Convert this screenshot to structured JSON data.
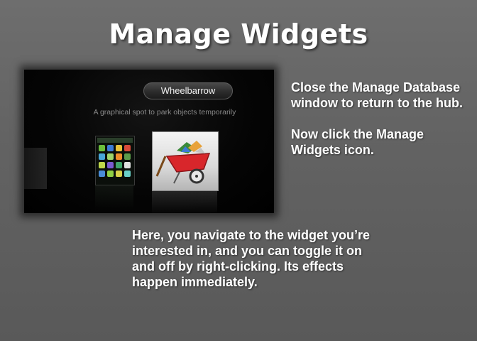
{
  "slide": {
    "title": "Manage Widgets",
    "instructions": [
      "Close the Manage Database window to return to the hub.",
      "Now click the Manage Widgets icon."
    ],
    "body": "Here, you navigate to the widget you’re interested in, and you can toggle it on and off by right-clicking.  Its effects happen immediately."
  },
  "screenshot": {
    "widget_name": "Wheelbarrow",
    "widget_description": "A graphical spot to park objects temporarily",
    "icons": [
      "app-grid-widget-icon",
      "wheelbarrow-widget-icon"
    ]
  },
  "colors": {
    "background": "#636363",
    "text": "#ffffff",
    "screenshot_bg": "#050505",
    "wheelbarrow_red": "#d8262b"
  }
}
